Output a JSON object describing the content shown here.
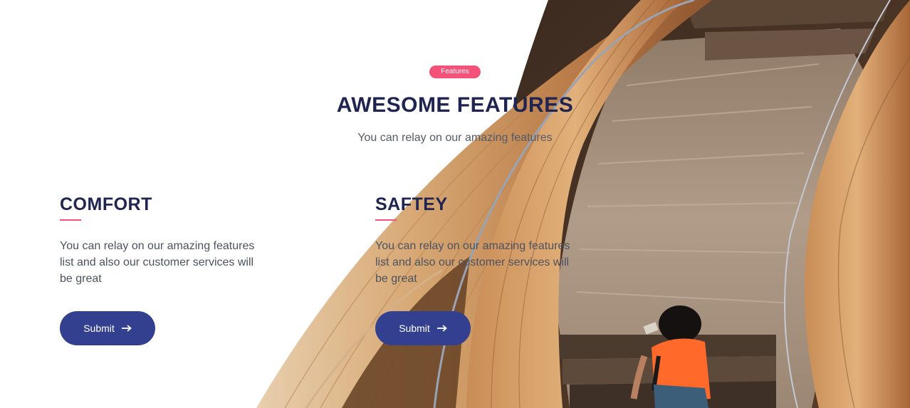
{
  "header": {
    "badge": "Features",
    "title": "AWESOME FEATURES",
    "subtitle": "You can relay on our amazing features"
  },
  "features": [
    {
      "title": "COMFORT",
      "text": "You can relay on our amazing features list and also our customer services will be great",
      "button_label": "Submit",
      "button_icon": "arrow-right-icon"
    },
    {
      "title": "SAFTEY",
      "text": "You can relay on our amazing features list and also our customer services will be great",
      "button_label": "Submit",
      "button_icon": "arrow-right-icon"
    }
  ],
  "colors": {
    "accent_pink": "#f5527a",
    "button_blue": "#333f8f",
    "title_navy": "#1f2450",
    "body_text": "#4d5260"
  }
}
